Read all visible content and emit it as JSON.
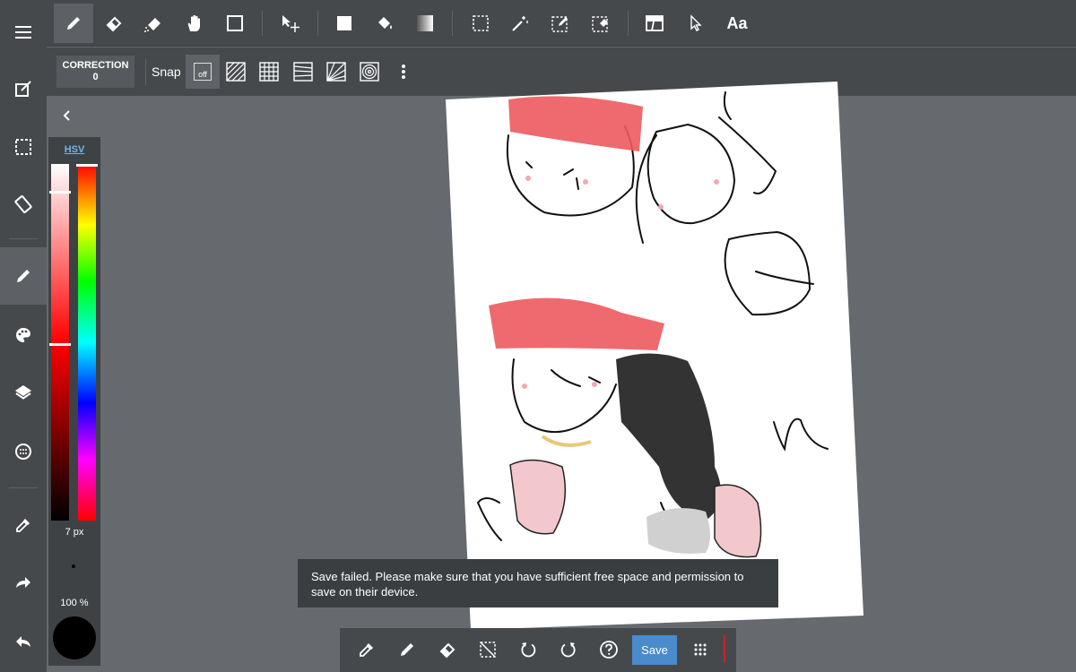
{
  "toolbar": {
    "tools": [
      "pen-icon",
      "eraser-icon",
      "blur-icon",
      "hand-icon",
      "shape-icon",
      "move-icon",
      "fill-rect-icon",
      "bucket-icon",
      "gradient-icon",
      "select-rect-icon",
      "magic-wand-icon",
      "select-pen-icon",
      "select-eraser-icon",
      "panel-icon",
      "operation-icon"
    ],
    "text_tool_label": "Aa"
  },
  "subbar": {
    "correction_label": "CORRECTION",
    "correction_value": "0",
    "snap_label": "Snap",
    "snap_off_label": "off"
  },
  "color_panel": {
    "mode_label": "HSV",
    "brush_size": "7 px",
    "opacity": "100 %",
    "current_color": "#000000"
  },
  "toast": {
    "message": "Save failed. Please make sure that you have sufficient free space and permission to save on their device."
  },
  "bottom_bar": {
    "save_label": "Save"
  },
  "colors": {
    "accent": "#4a8bcc",
    "toolbar_bg": "#46494c",
    "workspace_bg": "#666a6e"
  }
}
